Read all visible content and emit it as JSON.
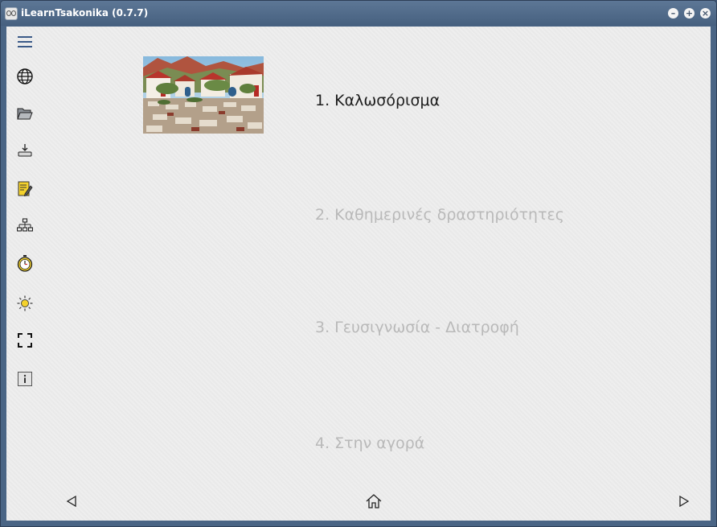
{
  "window": {
    "title": "iLearnTsakonika (0.7.7)",
    "controls": [
      {
        "name": "minimize-icon",
        "glyph": "–"
      },
      {
        "name": "maximize-icon",
        "glyph": "+"
      },
      {
        "name": "close-icon",
        "glyph": "×"
      }
    ]
  },
  "sidebar": {
    "items": [
      {
        "name": "menu-icon"
      },
      {
        "name": "globe-icon"
      },
      {
        "name": "folder-open-icon"
      },
      {
        "name": "download-icon"
      },
      {
        "name": "edit-notes-icon"
      },
      {
        "name": "sitemap-icon"
      },
      {
        "name": "timer-icon"
      },
      {
        "name": "brightness-icon"
      },
      {
        "name": "fullscreen-icon"
      },
      {
        "name": "info-icon"
      }
    ]
  },
  "lessons": [
    {
      "label": "1. Καλωσόρισμα",
      "active": true
    },
    {
      "label": "2. Καθημερινές δραστηριότητες",
      "active": false
    },
    {
      "label": "3. Γευσιγνωσία - Διατροφή",
      "active": false
    },
    {
      "label": "4. Στην αγορά",
      "active": false
    }
  ],
  "footer": {
    "items": [
      {
        "name": "prev-arrow-icon"
      },
      {
        "name": "home-icon"
      },
      {
        "name": "next-arrow-icon"
      }
    ]
  },
  "colors": {
    "titlebar": "#4f6a8a",
    "content_bg": "#eeeeee",
    "lesson_active": "#1d1d1d",
    "lesson_inactive": "#b9b9b9",
    "icon_blue": "#3b5a88",
    "icon_yellow": "#f4d22c"
  }
}
